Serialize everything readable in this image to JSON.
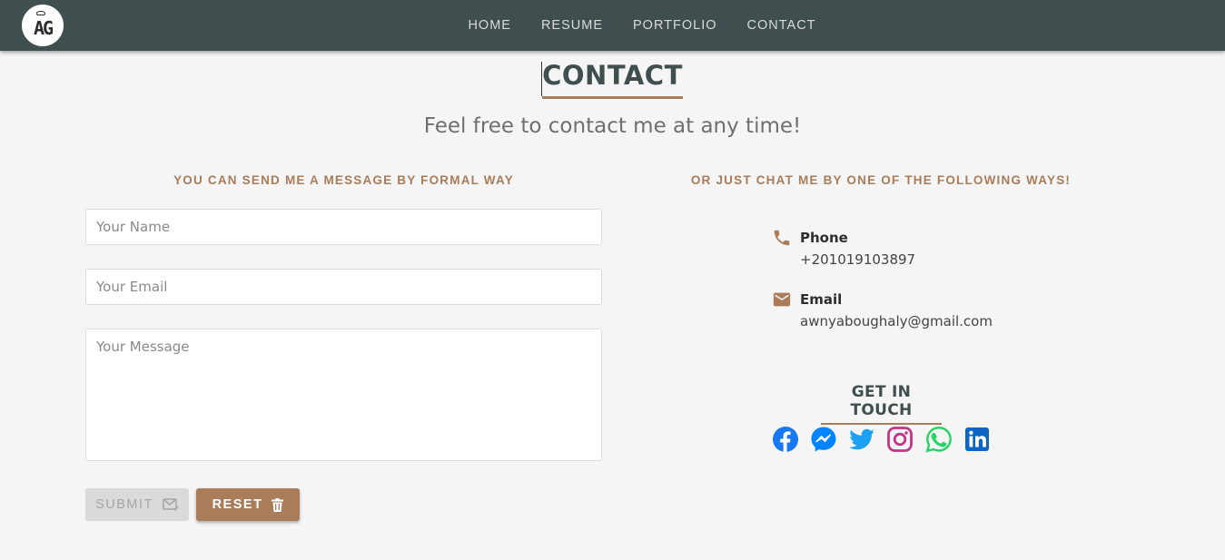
{
  "nav": {
    "logo_text": "AG",
    "links": [
      "HOME",
      "RESUME",
      "PORTFOLIO",
      "CONTACT"
    ]
  },
  "page": {
    "title": "CONTACT",
    "subtitle": "Feel free to contact me at any time!"
  },
  "form": {
    "heading": "YOU CAN SEND ME A MESSAGE BY FORMAL WAY",
    "name_placeholder": "Your Name",
    "email_placeholder": "Your Email",
    "message_placeholder": "Your Message",
    "submit_label": "SUBMIT",
    "reset_label": "RESET"
  },
  "info": {
    "heading": "OR JUST CHAT ME BY ONE OF THE FOLLOWING WAYS!",
    "phone_label": "Phone",
    "phone_value": "+201019103897",
    "email_label": "Email",
    "email_value": "awnyaboughaly@gmail.com"
  },
  "social": {
    "heading": "GET IN TOUCH",
    "icons": [
      "facebook-icon",
      "messenger-icon",
      "twitter-icon",
      "instagram-icon",
      "whatsapp-icon",
      "linkedin-icon"
    ]
  },
  "colors": {
    "navbar": "#3f4f4f",
    "accent": "#a97c5a",
    "background": "#f5f5f5"
  }
}
